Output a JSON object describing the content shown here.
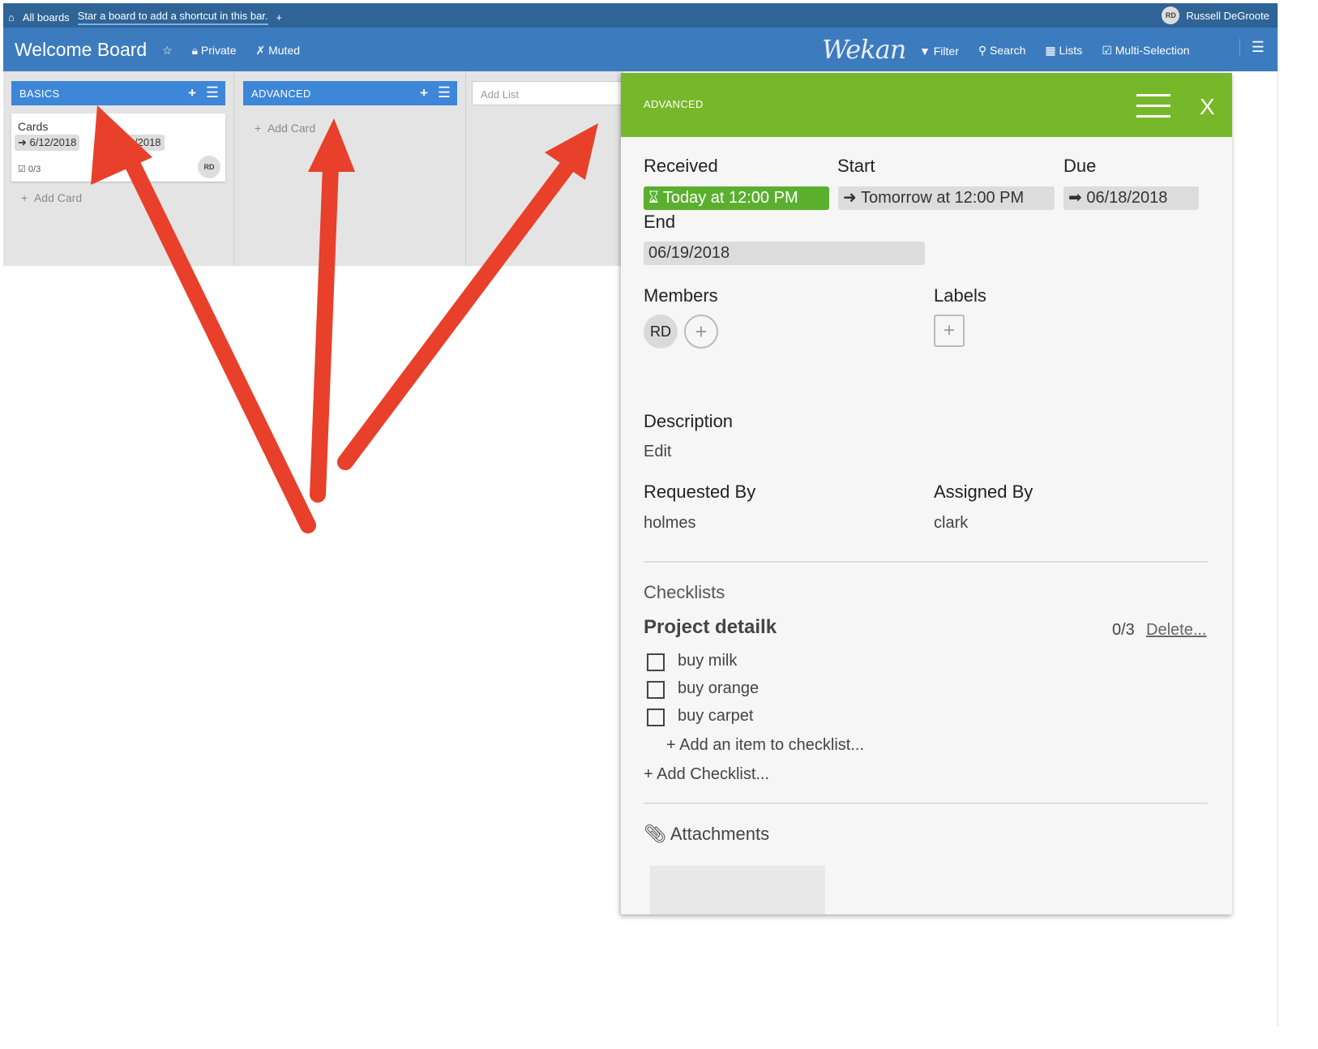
{
  "header": {
    "all_boards": "All boards",
    "shortcut_hint": "Star a board to add a shortcut in this bar.",
    "plus": "+",
    "user_initials": "RD",
    "user_name": "Russell DeGroote"
  },
  "board": {
    "title": "Welcome Board",
    "private_label": "Private",
    "muted_label": "Muted",
    "logo": "Wekan",
    "filter_label": "Filter",
    "search_label": "Search",
    "lists_label": "Lists",
    "multi_selection_label": "Multi-Selection"
  },
  "lists": [
    {
      "name": "BASICS",
      "card": {
        "title": "Cards",
        "badge1": "6/12/2018",
        "badge2": "/2018",
        "checklist": "0/3",
        "member": "RD"
      },
      "add_card": "Add Card"
    },
    {
      "name": "ADVANCED",
      "add_card": "Add Card"
    }
  ],
  "add_list_placeholder": "Add List",
  "detail": {
    "list_name": "ADVANCED",
    "close": "X",
    "received_label": "Received",
    "received_value": "Today at 12:00 PM",
    "start_label": "Start",
    "start_value": "Tomorrow at 12:00 PM",
    "due_label": "Due",
    "due_value": "06/18/2018",
    "end_label": "End",
    "end_value": "06/19/2018",
    "members_label": "Members",
    "member_initials": "RD",
    "labels_label": "Labels",
    "description_label": "Description",
    "description_edit": "Edit",
    "requested_by_label": "Requested By",
    "requested_by_value": "holmes",
    "assigned_by_label": "Assigned By",
    "assigned_by_value": "clark",
    "checklists_label": "Checklists",
    "checklist_title": "Project detailk",
    "checklist_progress": "0/3",
    "checklist_delete": "Delete...",
    "items": [
      "buy milk",
      "buy orange",
      "buy carpet"
    ],
    "add_item": "Add an item to checklist...",
    "add_checklist": "Add Checklist...",
    "attachments_label": "Attachments"
  },
  "colors": {
    "header_dark": "#2f6497",
    "header": "#3d7bbf",
    "list_header": "#3d86d8",
    "detail_header": "#77b82a",
    "received_green": "#5ab02e",
    "arrow_red": "#e8402a"
  }
}
